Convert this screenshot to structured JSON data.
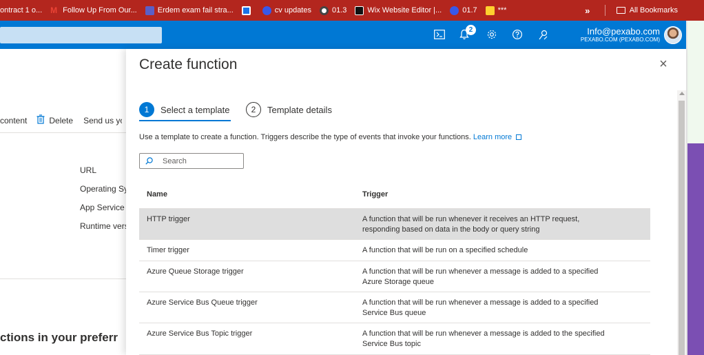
{
  "bookmarks": {
    "items": [
      {
        "label": "ontract 1 o...",
        "icon": "doc-icon",
        "color": "#ffffff"
      },
      {
        "label": "Follow Up From Our...",
        "icon": "gmail-icon",
        "color": "#ea4335"
      },
      {
        "label": "Erdem exam fail stra...",
        "icon": "teams-icon",
        "color": "#5b5fc7"
      },
      {
        "label": "",
        "icon": "calendar-icon",
        "color": "#1a73e8"
      },
      {
        "label": "cv updates",
        "icon": "wordpress-icon",
        "color": "#3858e9"
      },
      {
        "label": "01.3",
        "icon": "chatgpt-icon",
        "color": "#444444"
      },
      {
        "label": "Wix Website Editor |...",
        "icon": "wix-icon",
        "color": "#111111"
      },
      {
        "label": "01.7",
        "icon": "wordpress-icon",
        "color": "#3858e9"
      },
      {
        "label": "***",
        "icon": "miro-icon",
        "color": "#ffd02f"
      }
    ],
    "more": "»",
    "all_bookmarks": "All Bookmarks"
  },
  "topbar": {
    "notification_count": "2",
    "account_email": "Info@pexabo.com",
    "account_directory": "PEXABO.COM (PEXABO.COM)"
  },
  "background": {
    "toolbar_content": "content",
    "toolbar_delete": "Delete",
    "toolbar_send": "Send us yo",
    "props": [
      "URL",
      "Operating Sy",
      "App Service I",
      "Runtime vers"
    ],
    "heading": "ctions in your preferr"
  },
  "panel": {
    "title": "Create function",
    "close": "×",
    "steps": [
      {
        "num": "1",
        "label": "Select a template"
      },
      {
        "num": "2",
        "label": "Template details"
      }
    ],
    "description": "Use a template to create a function. Triggers describe the type of events that invoke your functions.",
    "learn_more": "Learn more",
    "search_placeholder": "Search",
    "columns": {
      "name": "Name",
      "trigger": "Trigger"
    },
    "rows": [
      {
        "name": "HTTP trigger",
        "trigger_1": "A function that will be run whenever it receives an HTTP request,",
        "trigger_2": "responding based on data in the body or query string"
      },
      {
        "name": "Timer trigger",
        "trigger_1": "A function that will be run on a specified schedule",
        "trigger_2": ""
      },
      {
        "name": "Azure Queue Storage trigger",
        "trigger_1": "A function that will be run whenever a message is added to a specified",
        "trigger_2": "Azure Storage queue"
      },
      {
        "name": "Azure Service Bus Queue trigger",
        "trigger_1": "A function that will be run whenever a message is added to a specified",
        "trigger_2": "Service Bus queue"
      },
      {
        "name": "Azure Service Bus Topic trigger",
        "trigger_1": "A function that will be run whenever a message is added to the specified",
        "trigger_2": "Service Bus topic"
      }
    ]
  },
  "colors": {
    "bookmarks_bar": "#b3261e",
    "azure_blue": "#0078d4",
    "selected_row": "#dedede"
  }
}
